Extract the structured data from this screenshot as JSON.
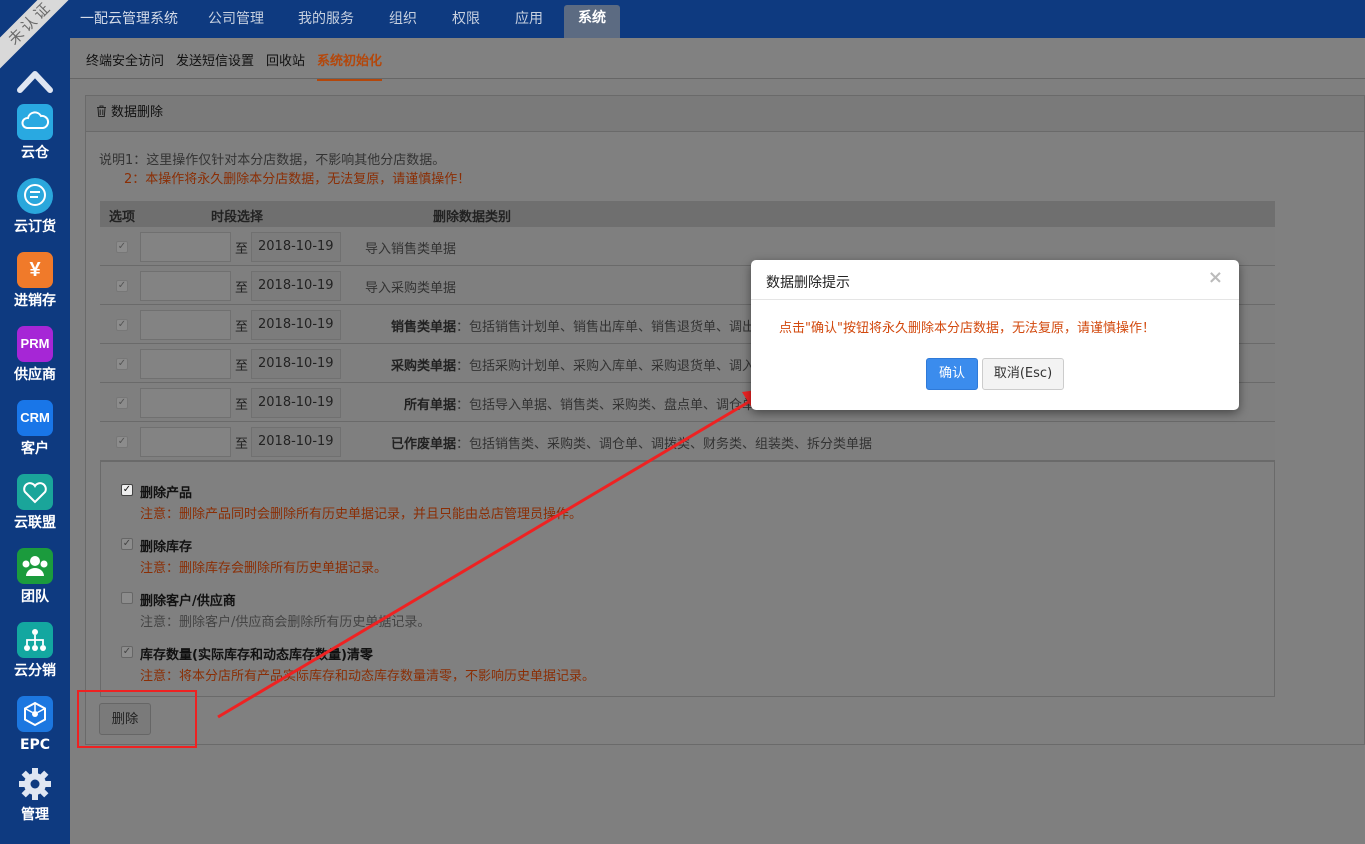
{
  "ribbon": "未认证",
  "sidebar": {
    "items": [
      {
        "label": "云仓",
        "icon": "cloud-icon"
      },
      {
        "label": "云订货",
        "icon": "chat-icon"
      },
      {
        "label": "进销存",
        "icon": "yuan-icon",
        "glyph": "¥"
      },
      {
        "label": "供应商",
        "icon": "prm-icon",
        "glyph": "PRM"
      },
      {
        "label": "客户",
        "icon": "crm-icon",
        "glyph": "CRM"
      },
      {
        "label": "云联盟",
        "icon": "heart-hands-icon"
      },
      {
        "label": "团队",
        "icon": "team-icon"
      },
      {
        "label": "云分销",
        "icon": "distribution-icon"
      },
      {
        "label": "EPC",
        "icon": "network-icon"
      },
      {
        "label": "管理",
        "icon": "gear-icon"
      }
    ]
  },
  "topnav": {
    "brand": "一配云管理系统",
    "items": [
      "公司管理",
      "我的服务",
      "组织",
      "权限",
      "应用",
      "系统"
    ],
    "active": "系统"
  },
  "subnav": {
    "items": [
      "终端安全访问",
      "发送短信设置",
      "回收站",
      "系统初始化"
    ],
    "active": "系统初始化"
  },
  "panel": {
    "title": "数据删除",
    "note1": "说明1：这里操作仅针对本分店数据，不影响其他分店数据。",
    "note2": "2：本操作将永久删除本分店数据，无法复原，请谨慎操作！",
    "table": {
      "headers": [
        "选项",
        "时段选择",
        "删除数据类别"
      ],
      "to_label": "至",
      "rows": [
        {
          "end_date": "2018-10-19",
          "name": "导入销售类单据",
          "desc": ""
        },
        {
          "end_date": "2018-10-19",
          "name": "导入采购类单据",
          "desc": ""
        },
        {
          "end_date": "2018-10-19",
          "name": "销售类单据",
          "desc": "：包括销售计划单、销售出库单、销售退货单、调出"
        },
        {
          "end_date": "2018-10-19",
          "name": "采购类单据",
          "desc": "：包括采购计划单、采购入库单、采购退货单、调入"
        },
        {
          "end_date": "2018-10-19",
          "name": "所有单据",
          "desc": "：包括导入单据、销售类、采购类、盘点单、调仓单"
        },
        {
          "end_date": "2018-10-19",
          "name": "已作废单据",
          "desc": "：包括销售类、采购类、调仓单、调拨类、财务类、组装类、拆分类单据"
        }
      ]
    },
    "options": [
      {
        "title": "删除产品",
        "note": "注意：删除产品同时会删除所有历史单据记录，并且只能由总店管理员操作。",
        "checked": true
      },
      {
        "title": "删除库存",
        "note": "注意：删除库存会删除所有历史单据记录。",
        "checked": true
      },
      {
        "title": "删除客户/供应商",
        "note": "注意：删除客户/供应商会删除所有历史单据记录。",
        "checked": false
      },
      {
        "title": "库存数量(实际库存和动态库存数量)清零",
        "note": "注意：将本分店所有产品实际库存和动态库存数量清零，不影响历史单据记录。",
        "checked": true
      }
    ],
    "delete_button": "删除"
  },
  "modal": {
    "title": "数据删除提示",
    "close": "×",
    "message": "点击\"确认\"按钮将永久删除本分店数据，无法复原，请谨慎操作！",
    "confirm": "确认",
    "cancel": "取消(Esc)"
  },
  "colors": {
    "nav": "#0e3a80",
    "warning_text": "#d2490e",
    "primary_button": "#3b8ced",
    "annotation_red": "#ee2222"
  }
}
